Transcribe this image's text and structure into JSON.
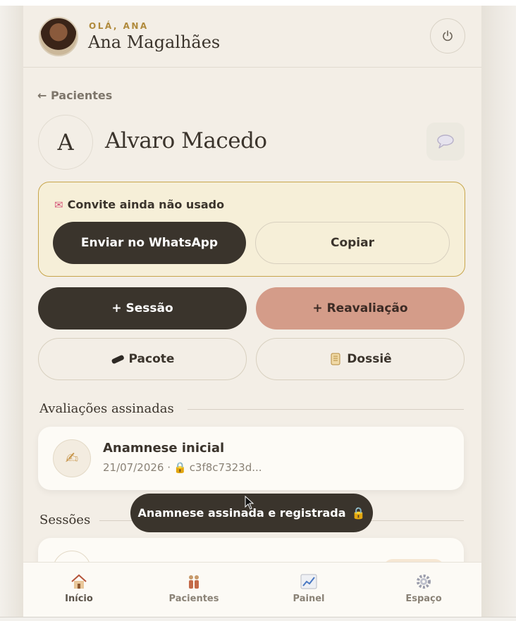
{
  "header": {
    "greeting": "OLÁ, ANA",
    "user_name": "Ana Magalhães",
    "logout_icon": "power-icon"
  },
  "nav_back": "← Pacientes",
  "patient": {
    "initial": "A",
    "name": "Alvaro Macedo",
    "chat_icon": "speech-bubble-icon"
  },
  "invite": {
    "icon": "envelope-heart-icon",
    "title": "Convite ainda não usado",
    "whatsapp_label": "Enviar no WhatsApp",
    "copy_label": "Copiar"
  },
  "actions": {
    "session_label": "+ Sessão",
    "reassessment_label": "+ Reavaliação",
    "package_label": "Pacote",
    "package_icon": "bandage-icon",
    "dossier_label": "Dossiê",
    "dossier_icon": "scroll-icon"
  },
  "evaluations": {
    "heading": "Avaliações assinadas",
    "items": [
      {
        "title": "Anamnese inicial",
        "date": "21/07/2026 ·",
        "hash": "c3f8c7323d...",
        "icon": "writing-hand-icon"
      }
    ]
  },
  "sessions": {
    "heading": "Sessões"
  },
  "toast": {
    "message": "Anamnese assinada e registrada"
  },
  "bottom_nav": [
    {
      "label": "Início",
      "icon": "house-icon",
      "active": true
    },
    {
      "label": "Pacientes",
      "icon": "people-icon",
      "active": false
    },
    {
      "label": "Painel",
      "icon": "chart-icon",
      "active": false
    },
    {
      "label": "Espaço",
      "icon": "gear-icon",
      "active": false
    }
  ],
  "colors": {
    "background": "#f3eee6",
    "dark_button": "#3a342c",
    "rose_button": "#d49c89",
    "invite_bg": "#f6efd8",
    "invite_border": "#c7a54b",
    "accent_gold": "#b08a3c"
  }
}
